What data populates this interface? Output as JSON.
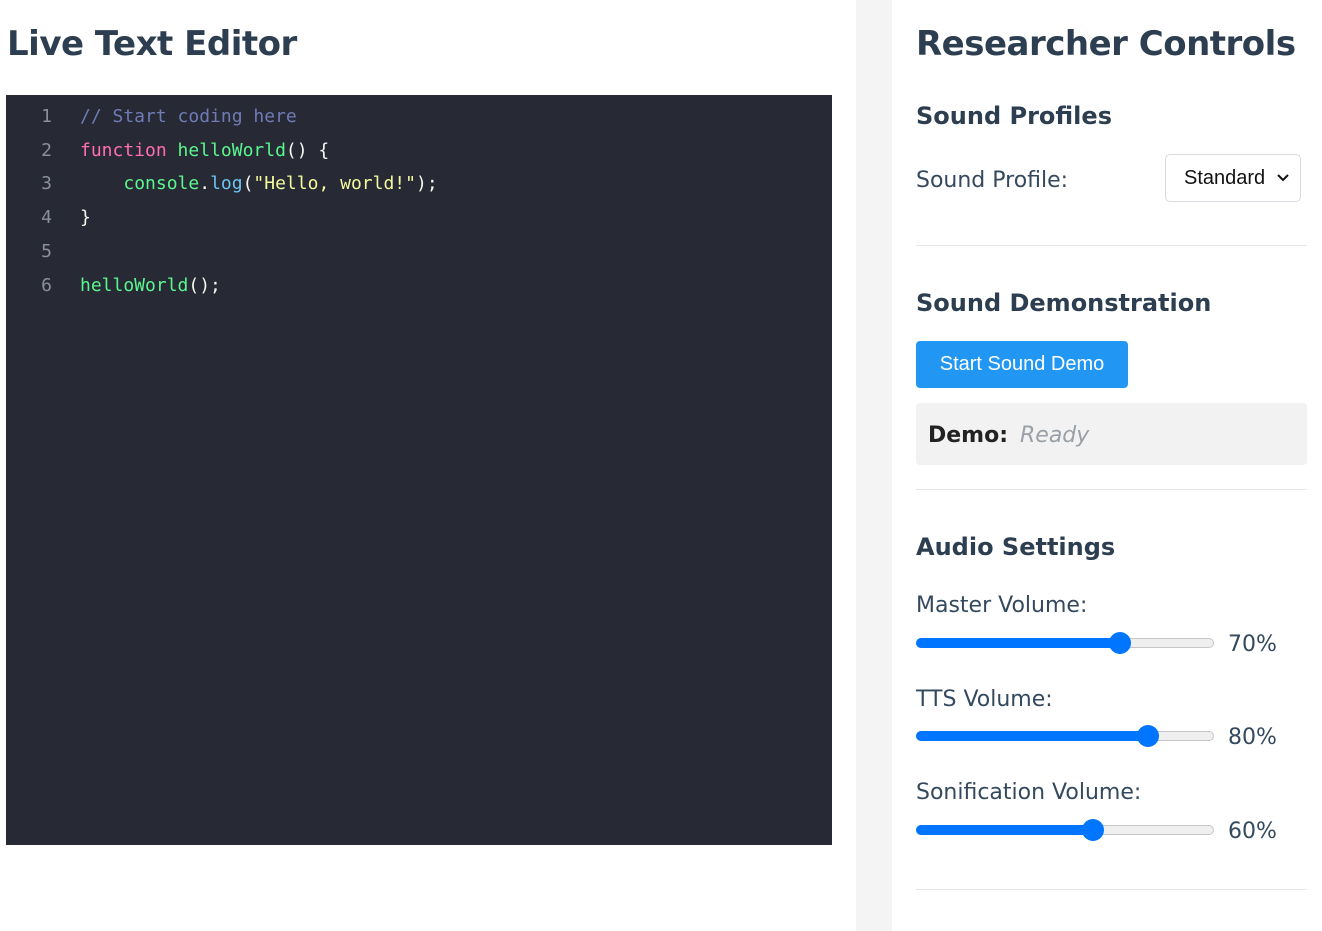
{
  "editor": {
    "title": "Live Text Editor",
    "lines": [
      {
        "num": "1",
        "tokens": [
          {
            "t": "comment",
            "v": "// Start coding here"
          }
        ]
      },
      {
        "num": "2",
        "tokens": [
          {
            "t": "keyword",
            "v": "function"
          },
          {
            "t": "punc",
            "v": " "
          },
          {
            "t": "func",
            "v": "helloWorld"
          },
          {
            "t": "punc",
            "v": "() {"
          }
        ]
      },
      {
        "num": "3",
        "tokens": [
          {
            "t": "punc",
            "v": "    "
          },
          {
            "t": "func",
            "v": "console"
          },
          {
            "t": "punc",
            "v": "."
          },
          {
            "t": "method",
            "v": "log"
          },
          {
            "t": "punc",
            "v": "("
          },
          {
            "t": "string",
            "v": "\"Hello, world!\""
          },
          {
            "t": "punc",
            "v": ");"
          }
        ]
      },
      {
        "num": "4",
        "tokens": [
          {
            "t": "punc",
            "v": "}"
          }
        ]
      },
      {
        "num": "5",
        "tokens": []
      },
      {
        "num": "6",
        "tokens": [
          {
            "t": "func",
            "v": "helloWorld"
          },
          {
            "t": "punc",
            "v": "();"
          }
        ]
      }
    ]
  },
  "controls": {
    "title": "Researcher Controls",
    "sound_profiles": {
      "heading": "Sound Profiles",
      "label": "Sound Profile:",
      "selected": "Standard"
    },
    "demonstration": {
      "heading": "Sound Demonstration",
      "button_label": "Start Sound Demo",
      "status_label": "Demo:",
      "status_value": "Ready"
    },
    "audio": {
      "heading": "Audio Settings",
      "sliders": [
        {
          "label": "Master Volume:",
          "value": 70,
          "display": "70%"
        },
        {
          "label": "TTS Volume:",
          "value": 80,
          "display": "80%"
        },
        {
          "label": "Sonification Volume:",
          "value": 60,
          "display": "60%"
        }
      ]
    }
  },
  "colors": {
    "accent": "#2196f3",
    "slider": "#0075ff",
    "editor_bg": "#272935"
  }
}
